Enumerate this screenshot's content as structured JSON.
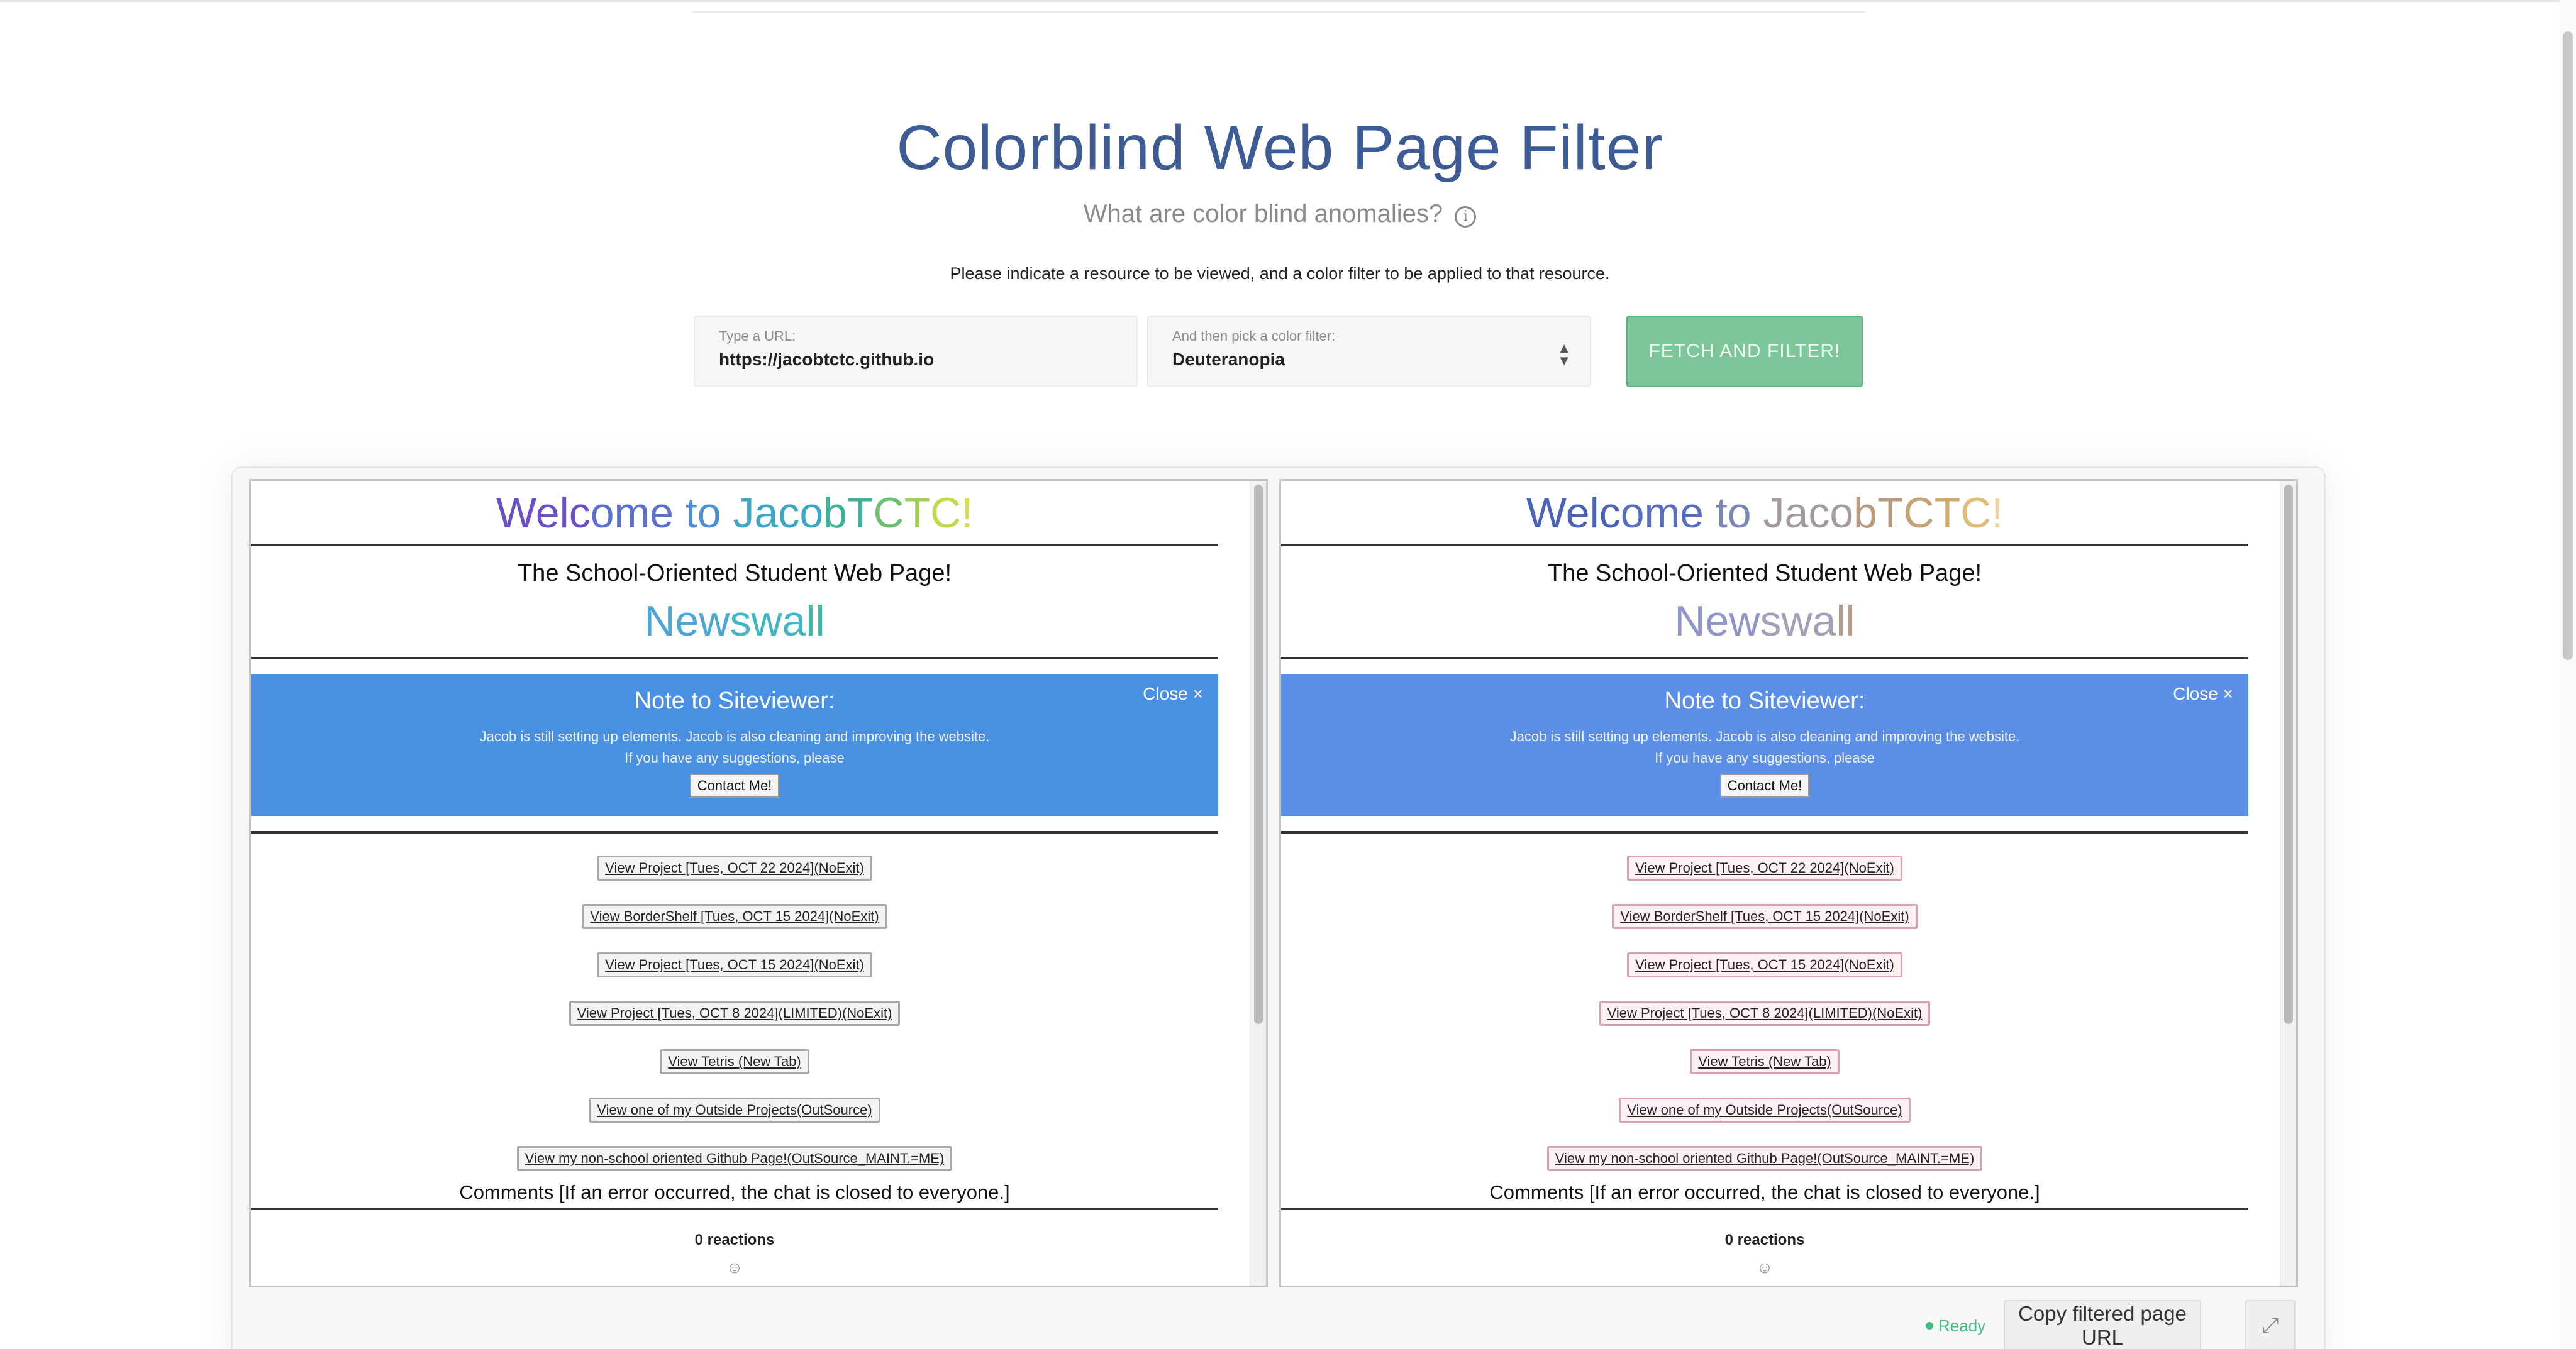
{
  "header": {
    "title": "Colorblind Web Page Filter",
    "subtitle": "What are color blind anomalies?",
    "info_icon": "i",
    "instruction": "Please indicate a resource to be viewed, and a color filter to be applied to that resource."
  },
  "form": {
    "url_label": "Type a URL:",
    "url_value": "https://jacobtctc.github.io",
    "filter_label": "And then pick a color filter:",
    "filter_value": "Deuteranopia",
    "fetch_label": "FETCH AND FILTER!"
  },
  "site": {
    "welcome_parts": [
      "Welc",
      "ome ",
      "to ",
      "Jaco",
      "bT",
      "C",
      "T",
      "C",
      "!"
    ],
    "subhead": "The School-Oriented Student Web Page!",
    "newswall_parts": [
      "New",
      "swa",
      "ll"
    ],
    "note_title": "Note to Siteviewer:",
    "close_label": "Close ×",
    "note_line1": "Jacob is still setting up elements. Jacob is also cleaning and improving the website.",
    "note_line2": "If you have any suggestions, please",
    "contact_label": "Contact Me!",
    "links": [
      "View Project [Tues, OCT 22 2024](NoExit)",
      "View BorderShelf [Tues, OCT 15 2024](NoExit)",
      "View Project [Tues, OCT 15 2024](NoExit)",
      "View Project [Tues, OCT 8 2024](LIMITED)(NoExit)",
      "View Tetris (New Tab)",
      "View one of my Outside Projects(OutSource)",
      "View my non-school oriented Github Page!(OutSource_MAINT.=ME)"
    ],
    "comments": "Comments [If an error occurred, the chat is closed to everyone.]",
    "reactions": "0 reactions",
    "smiley": "☺"
  },
  "colors": {
    "original": {
      "welcome": [
        "#6b4fc9",
        "#5b6fd0",
        "#4d8fd6",
        "#3da6c4",
        "#3eb39a",
        "#6cc06f",
        "#9fcf55",
        "#c3d94a",
        "#d8e048"
      ],
      "newswall": [
        "#4aa6d6",
        "#42b5c2",
        "#3fb8a6"
      ],
      "note_bg": "#4a90e2",
      "link_border": "#a8a8a8",
      "link_bg": "#f3f3f3"
    },
    "filtered": {
      "welcome": [
        "#4a62b8",
        "#5a6ec0",
        "#7a86b8",
        "#a59aa0",
        "#b89a7e",
        "#c2a474",
        "#cdaa6c",
        "#e1bc78",
        "#f0d3a3"
      ],
      "newswall": [
        "#8f95c9",
        "#a49fb6",
        "#b29c8f"
      ],
      "note_bg": "#5b8ee6",
      "link_border": "#d9a0b0",
      "link_bg": "#fdf0f3"
    }
  },
  "footer": {
    "status": "Ready",
    "copy_label": "Copy filtered page URL",
    "expand_icon": "⤢"
  }
}
